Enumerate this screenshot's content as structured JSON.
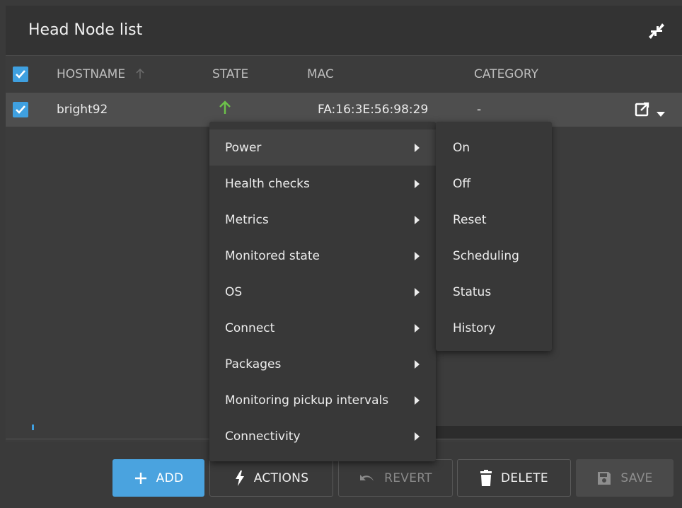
{
  "header": {
    "title": "Head Node list",
    "collapse_icon": "collapse-arrows-icon"
  },
  "table": {
    "columns": [
      "HOSTNAME",
      "STATE",
      "MAC",
      "CATEGORY"
    ],
    "sort_icon": "arrow-up-icon",
    "rows": [
      {
        "hostname": "bright92",
        "state_icon": "arrow-up-icon",
        "state_color": "#6cc24a",
        "mac": "FA:16:3E:56:98:29",
        "category": "-"
      }
    ]
  },
  "context_menu": {
    "items": [
      {
        "label": "Power"
      },
      {
        "label": "Health checks"
      },
      {
        "label": "Metrics"
      },
      {
        "label": "Monitored state"
      },
      {
        "label": "OS"
      },
      {
        "label": "Connect"
      },
      {
        "label": "Packages"
      },
      {
        "label": "Monitoring pickup intervals"
      },
      {
        "label": "Connectivity"
      }
    ],
    "submenu": [
      "On",
      "Off",
      "Reset",
      "Scheduling",
      "Status",
      "History"
    ]
  },
  "footer": {
    "add": "ADD",
    "actions": "ACTIONS",
    "revert": "REVERT",
    "delete": "DELETE",
    "save": "SAVE"
  },
  "colors": {
    "accent": "#4aa3df",
    "checkbox": "#3fa0e0",
    "state_up": "#6cc24a"
  }
}
